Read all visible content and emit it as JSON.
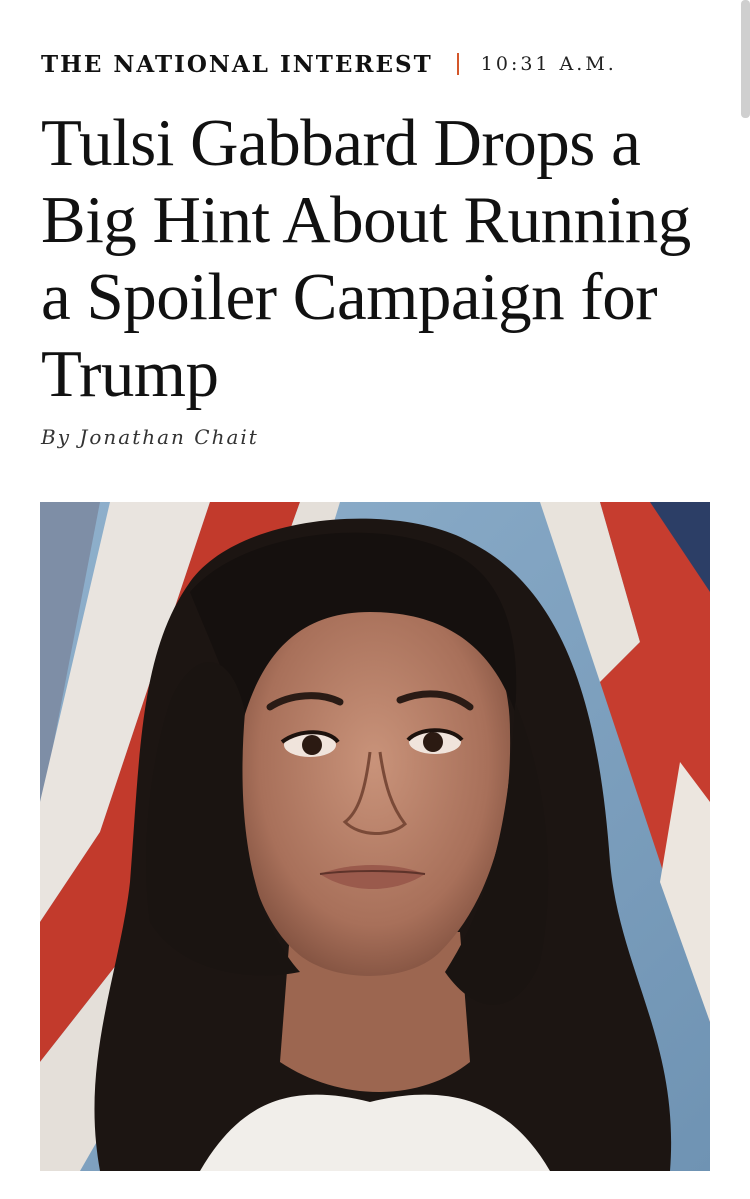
{
  "article": {
    "section": "THE NATIONAL INTEREST",
    "time": "10:31 A.M.",
    "headline": "Tulsi Gabbard Drops a Big Hint About Running a Spoiler Campaign for Trump",
    "byline": "By Jonathan Chait"
  },
  "colors": {
    "divider_accent": "#d4572a",
    "text": "#111111",
    "background": "#ffffff"
  }
}
